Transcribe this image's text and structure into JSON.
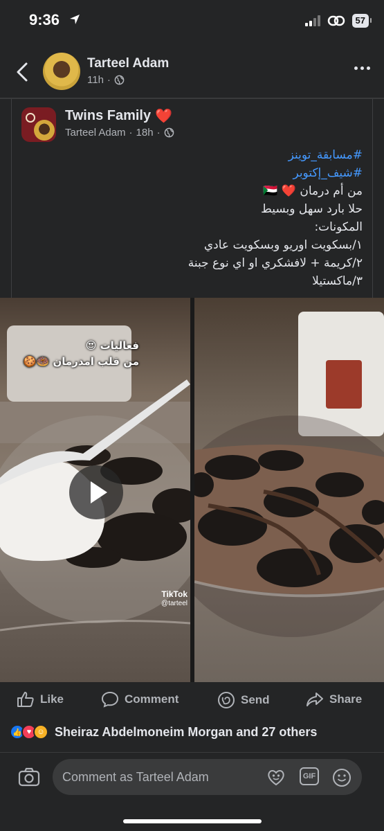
{
  "status_bar": {
    "time": "9:36",
    "battery": "57"
  },
  "header": {
    "name": "Tarteel Adam",
    "time": "11h"
  },
  "shared_post": {
    "page_name": "Twins  Family",
    "heart": "❤️",
    "author": "Tarteel Adam",
    "time": "18h",
    "lines": [
      {
        "text": "#مسابقة_توينز",
        "tag": true
      },
      {
        "text": "#شيف_إكتوبر",
        "tag": true
      },
      {
        "text": "من أم درمان ❤️ 🇸🇩",
        "tag": false
      },
      {
        "text": "حلا بارد سهل وبسيط",
        "tag": false
      },
      {
        "text": "المكونات:",
        "tag": false
      },
      {
        "text": "١/بسكويت اوريو وبسكويت عادي",
        "tag": false
      },
      {
        "text": "٢/كريمة + لافشكري او اي نوع جبنة",
        "tag": false
      },
      {
        "text": "٣/ماكستيلا",
        "tag": false
      }
    ]
  },
  "media": {
    "overlay_line1": "فعاليات 😍",
    "overlay_line2": "من قلب امدرمان 🍩🍪",
    "tiktok_label": "TikTok",
    "tiktok_user": "@tarteel"
  },
  "actions": {
    "like": "Like",
    "comment": "Comment",
    "send": "Send",
    "share": "Share"
  },
  "reactions": {
    "text": "Sheiraz Abdelmoneim Morgan and 27 others"
  },
  "comment_bar": {
    "placeholder": "Comment as Tarteel Adam"
  },
  "colors": {
    "background": "#242526",
    "text": "#e4e6eb",
    "secondary": "#b0b3b8",
    "hashtag": "#4599ff",
    "like_blue": "#1877f2"
  }
}
